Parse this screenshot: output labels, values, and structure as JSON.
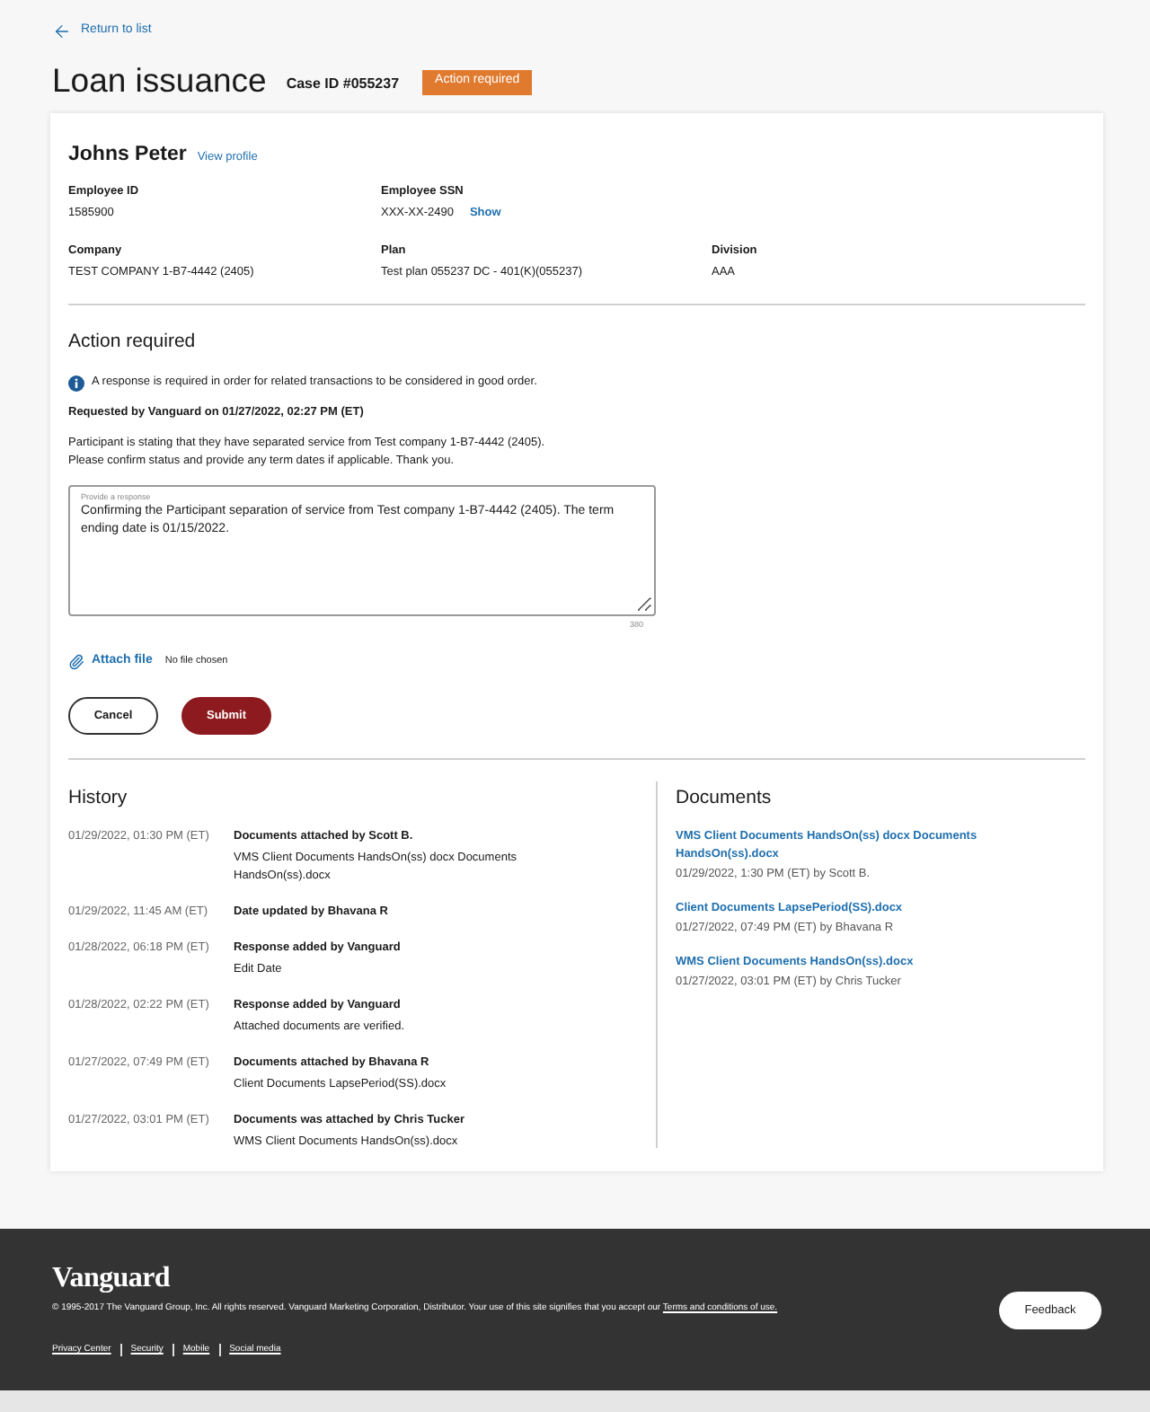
{
  "back_link": "Return to list",
  "header": {
    "title": "Loan issuance",
    "case_id": "Case ID #055237",
    "status_badge": "Action required"
  },
  "participant": {
    "name": "Johns Peter",
    "profile_link": "View profile",
    "rows": [
      [
        {
          "label": "Employee ID",
          "value": "1585900"
        },
        {
          "label": "Employee SSN",
          "value": "XXX-XX-2490",
          "action": "Show"
        }
      ],
      [
        {
          "label": "Company",
          "value": "TEST COMPANY 1-B7-4442 (2405)"
        },
        {
          "label": "Plan",
          "value": "Test plan 055237 DC - 401(K)(055237)"
        },
        {
          "label": "Division",
          "value": "AAA"
        }
      ]
    ]
  },
  "action_required": {
    "heading": "Action required",
    "notice": "A response is required in order for related transactions to be considered in good order.",
    "requested_by": "Requested by Vanguard on 01/27/2022, 02:27 PM (ET)",
    "message": [
      "Participant is stating that they have separated service from Test company 1-B7-4442 (2405).",
      "Please confirm status and provide any term dates if applicable. Thank you."
    ],
    "response": {
      "label": "Provide a response",
      "value": "Confirming the Participant separation of service from Test company 1-B7-4442 (2405). The term ending date is 01/15/2022.",
      "char_count": "380"
    },
    "attachment": {
      "link": "Attach file",
      "status": "No file chosen"
    },
    "buttons": [
      {
        "label": "Cancel",
        "kind": "secondary"
      },
      {
        "label": "Submit",
        "kind": "primary"
      }
    ]
  },
  "history": {
    "heading": "History",
    "entries": [
      {
        "time": "01/29/2022, 01:30 PM (ET)",
        "title": "Documents attached by Scott B.",
        "detail": "VMS Client Documents HandsOn(ss) docx Documents HandsOn(ss).docx"
      },
      {
        "time": "01/29/2022, 11:45 AM (ET)",
        "title": "Date updated by Bhavana R"
      },
      {
        "time": "01/28/2022, 06:18 PM (ET)",
        "title": "Response added by Vanguard",
        "detail": "Edit Date"
      },
      {
        "time": "01/28/2022, 02:22 PM (ET)",
        "title": "Response added by Vanguard",
        "detail": "Attached documents are verified."
      },
      {
        "time": "01/27/2022, 07:49 PM (ET)",
        "title": "Documents attached by Bhavana R",
        "detail": "Client Documents LapsePeriod(SS).docx"
      },
      {
        "time": "01/27/2022, 03:01 PM (ET)",
        "title": "Documents was attached by Chris Tucker",
        "detail": "WMS Client Documents HandsOn(ss).docx"
      }
    ]
  },
  "documents": {
    "heading": "Documents",
    "items": [
      {
        "name": "VMS Client Documents HandsOn(ss) docx Documents HandsOn(ss).docx",
        "meta": "01/29/2022, 1:30 PM (ET) by Scott B."
      },
      {
        "name": "Client Documents LapsePeriod(SS).docx",
        "meta": "01/27/2022, 07:49 PM (ET) by Bhavana R"
      },
      {
        "name": "WMS Client Documents HandsOn(ss).docx",
        "meta": "01/27/2022, 03:01 PM (ET) by Chris Tucker"
      }
    ]
  },
  "footer": {
    "logo": "Vanguard",
    "copyright": "© 1995-2017 The Vanguard Group, Inc. All rights reserved. Vanguard Marketing Corporation, Distributor. Your use of this site signifies that you accept our",
    "terms_link": "Terms and conditions of use.",
    "links": [
      "Privacy Center",
      "Security",
      "Mobile",
      "Social media"
    ],
    "feedback_button": "Feedback"
  }
}
